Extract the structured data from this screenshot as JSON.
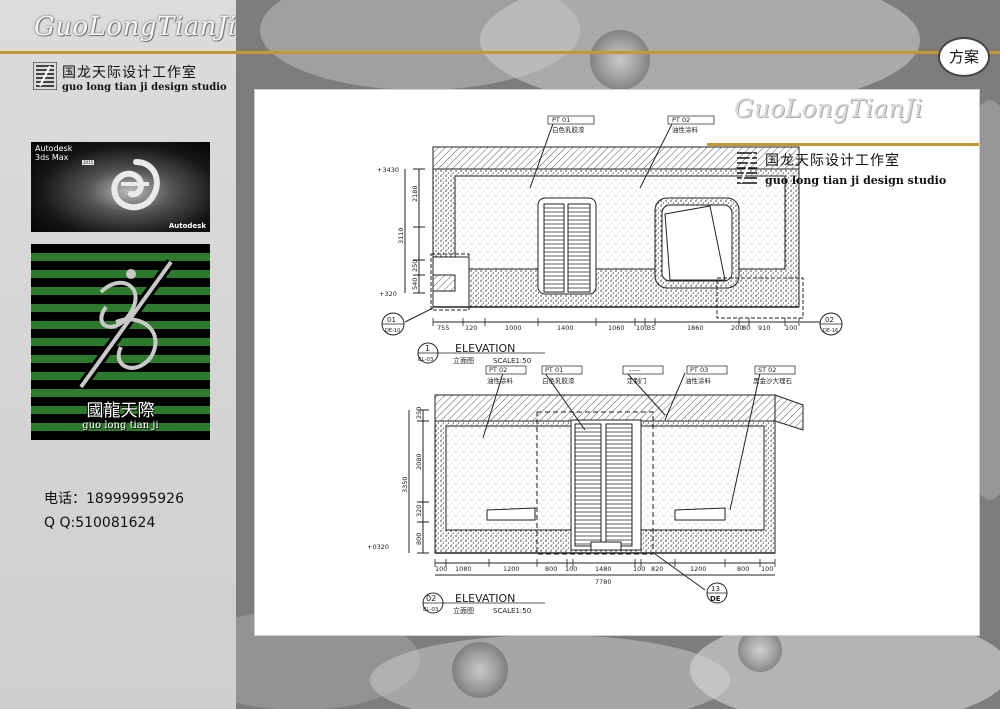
{
  "header": {
    "brand_title": "GuoLongTianJi",
    "badge": "方案"
  },
  "studio": {
    "name_cn": "国龙天际设计工作室",
    "name_en": "guo long tian ji design studio"
  },
  "software_box": {
    "title": "Autodesk\n3ds Max",
    "year": "2015",
    "vendor": "Autodesk"
  },
  "logo_box": {
    "name_cn": "國龍天際",
    "name_en": "guo long tian ji"
  },
  "contact": {
    "phone": "电话：18999995926",
    "qq": "Q  Q:510081624"
  },
  "sheet": {
    "title": "GuoLongTianJi",
    "studio_cn": "国龙天际设计工作室",
    "studio_en": "guo long tian ji design studio",
    "elevation1": {
      "number": "1",
      "sheet_ref": "EL-03",
      "label": "ELEVATION",
      "name_cn": "立面图",
      "scale": "SCALE1:50",
      "tags": [
        {
          "code": "PT 01",
          "text": "白色乳胶漆"
        },
        {
          "code": "PT 02",
          "text": "油性涂料"
        }
      ],
      "levels": [
        "+3430",
        "+320"
      ],
      "vertical_dims": [
        "2180",
        "3110",
        "250",
        "540"
      ],
      "horizontal_dims": [
        "755",
        "120",
        "1000",
        "1400",
        "1060",
        "100",
        "35",
        "1860",
        "200",
        "80",
        "910",
        "100"
      ],
      "callout_left": {
        "num": "01",
        "ref": "DE-10"
      },
      "callout_right": {
        "num": "02",
        "ref": "DE-16"
      }
    },
    "elevation2": {
      "number": "02",
      "sheet_ref": "EL-03",
      "label": "ELEVATION",
      "name_cn": "立面图",
      "scale": "SCALE1:50",
      "tags": [
        {
          "code": "PT 02",
          "text": "油性涂料"
        },
        {
          "code": "PT 01",
          "text": "白色乳胶漆"
        },
        {
          "code": "-----",
          "text": "定制门"
        },
        {
          "code": "PT 03",
          "text": "油性涂料"
        },
        {
          "code": "ST 02",
          "text": "黑金沙大理石"
        }
      ],
      "levels": [
        "+0320"
      ],
      "vertical_dims": [
        "250",
        "2080",
        "3350",
        "320",
        "800"
      ],
      "horizontal_dims": [
        "100",
        "1080",
        "1200",
        "800",
        "100",
        "1480",
        "100",
        "820",
        "1200",
        "800",
        "100"
      ],
      "total": "7780",
      "callout": {
        "num": "13",
        "ref": "DE"
      }
    }
  }
}
